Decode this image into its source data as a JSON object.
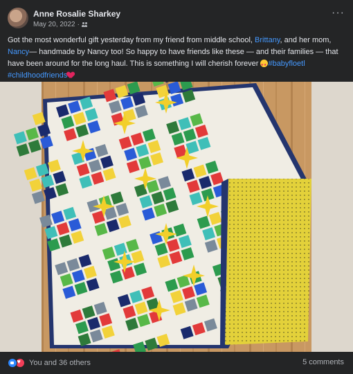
{
  "post": {
    "author": "Anne Rosalie Sharkey",
    "date": "May 20, 2022",
    "date_separator": "·",
    "audience_icon": "friends-icon",
    "more_icon": "more-horizontal-icon",
    "more_label": "···"
  },
  "caption": {
    "part1": "Got the most wonderful gift yesterday from my friend from middle school, ",
    "link1": "Brittany",
    "part2": ", and her mom, ",
    "link2": "Nancy",
    "part3": "— handmade by Nancy too! So happy to have friends like these — and their families — that have been around for the long haul. This is something I will cherish forever ",
    "emoji1": "star-struck-emoji",
    "hashtag1": "#babyfloetl",
    "hashtag2": "#childhoodfriends",
    "emoji2": "red-heart-emoji"
  },
  "photo": {
    "subject": "quilt-photo",
    "colors": {
      "floor": "#c89862",
      "wall": "#d8d2c8",
      "binding": "#24356e",
      "sashing": "#f0ede4",
      "star": "#f2cf2a",
      "backing": "#e3d13a"
    }
  },
  "footer": {
    "reactions_text": "You and 36 others",
    "comments_text": "5 comments",
    "like_icon": "like-reaction-icon",
    "love_icon": "love-reaction-icon"
  },
  "theme": {
    "background": "#242526",
    "text": "#e4e6eb",
    "secondary_text": "#b0b3b8",
    "link": "#4599ff"
  }
}
